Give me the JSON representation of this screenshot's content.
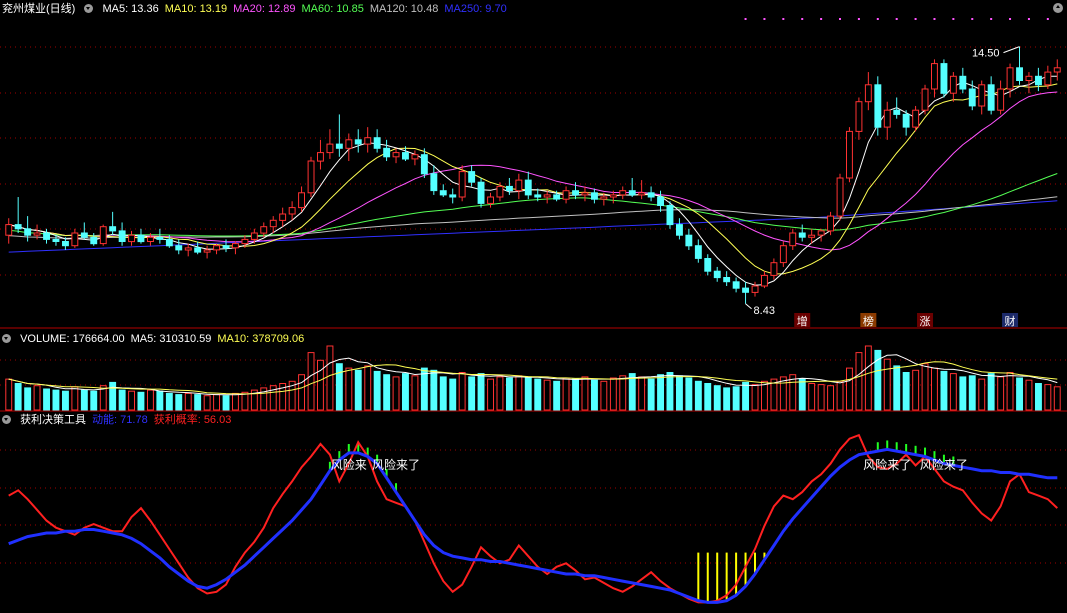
{
  "colors": {
    "up": "#ff3232",
    "down": "#54ffff",
    "ma5": "#ffffff",
    "ma10": "#ffff54",
    "ma20": "#ff54ff",
    "ma60": "#54ff54",
    "ma120": "#c0c0c0",
    "ma250": "#3030ff",
    "divider": "#b40000",
    "grid": "#a00000"
  },
  "price_panel": {
    "title": "兖州煤业(日线)",
    "ma_labels": [
      {
        "text": "MA5: 13.36",
        "color": "#ffffff"
      },
      {
        "text": "MA10: 13.19",
        "color": "#ffff54"
      },
      {
        "text": "MA20: 12.89",
        "color": "#ff54ff"
      },
      {
        "text": "MA60: 10.85",
        "color": "#54ff54"
      },
      {
        "text": "MA120: 10.48",
        "color": "#c0c0c0"
      },
      {
        "text": "MA250: 9.70",
        "color": "#3030ff"
      }
    ],
    "high_label": "14.50",
    "low_label": "8.43",
    "event_tags": [
      {
        "text": "增",
        "color": "#ffffff",
        "bg": "#6a0000",
        "bar": 84
      },
      {
        "text": "榜",
        "color": "#ffffff",
        "bg": "#8a3a00",
        "bar": 91
      },
      {
        "text": "涨",
        "color": "#ffffff",
        "bg": "#6a0000",
        "bar": 97
      },
      {
        "text": "财",
        "color": "#ffffff",
        "bg": "#1c2a6a",
        "bar": 106
      }
    ]
  },
  "volume_panel": {
    "labels": [
      {
        "text": "VOLUME: 176664.00",
        "color": "#ffffff"
      },
      {
        "text": "MA5: 310310.59",
        "color": "#ffffff"
      },
      {
        "text": "MA10: 378709.06",
        "color": "#ffff54"
      }
    ]
  },
  "indicator_panel": {
    "labels": [
      {
        "text": "获利决策工具",
        "color": "#ffffff"
      },
      {
        "text": "动能: 71.78",
        "color": "#3030ff"
      },
      {
        "text": "获利概率: 56.03",
        "color": "#ff2020"
      }
    ],
    "warning_text": "风险来了",
    "warnings": [
      {
        "text": "风险来",
        "bar": 36
      },
      {
        "text": "风险来了",
        "bar": 41
      },
      {
        "text": "风险来了",
        "bar": 93
      },
      {
        "text": "风险来了",
        "bar": 99
      }
    ]
  },
  "chart_data": [
    {
      "type": "candlestick",
      "name": "兖州煤业(日线)",
      "ylim": [
        8.0,
        15.2
      ],
      "ohlc": [
        [
          10.05,
          10.45,
          9.85,
          10.3
        ],
        [
          10.3,
          10.95,
          10.1,
          10.2
        ],
        [
          10.2,
          10.5,
          9.9,
          10.05
        ],
        [
          10.05,
          10.3,
          9.95,
          10.1
        ],
        [
          10.1,
          10.2,
          9.85,
          9.95
        ],
        [
          9.95,
          10.05,
          9.8,
          9.9
        ],
        [
          9.9,
          10.0,
          9.7,
          9.8
        ],
        [
          9.8,
          10.2,
          9.75,
          10.1
        ],
        [
          10.1,
          10.35,
          9.95,
          10.0
        ],
        [
          10.0,
          10.1,
          9.8,
          9.85
        ],
        [
          9.85,
          10.3,
          9.8,
          10.25
        ],
        [
          10.25,
          10.6,
          10.05,
          10.15
        ],
        [
          10.15,
          10.35,
          9.8,
          9.9
        ],
        [
          9.9,
          10.15,
          9.8,
          10.05
        ],
        [
          10.05,
          10.2,
          9.85,
          9.9
        ],
        [
          9.9,
          10.1,
          9.8,
          10.0
        ],
        [
          10.0,
          10.2,
          9.85,
          9.95
        ],
        [
          9.95,
          10.05,
          9.75,
          9.8
        ],
        [
          9.8,
          9.95,
          9.6,
          9.7
        ],
        [
          9.7,
          9.85,
          9.55,
          9.75
        ],
        [
          9.75,
          9.9,
          9.6,
          9.65
        ],
        [
          9.65,
          9.8,
          9.5,
          9.7
        ],
        [
          9.7,
          9.85,
          9.6,
          9.8
        ],
        [
          9.8,
          9.95,
          9.65,
          9.75
        ],
        [
          9.75,
          9.9,
          9.6,
          9.85
        ],
        [
          9.85,
          10.05,
          9.75,
          9.95
        ],
        [
          9.95,
          10.2,
          9.85,
          10.1
        ],
        [
          10.1,
          10.35,
          10.0,
          10.25
        ],
        [
          10.25,
          10.5,
          10.1,
          10.4
        ],
        [
          10.4,
          10.7,
          10.25,
          10.55
        ],
        [
          10.55,
          10.85,
          10.4,
          10.7
        ],
        [
          10.7,
          11.2,
          10.6,
          11.05
        ],
        [
          11.05,
          11.9,
          10.95,
          11.8
        ],
        [
          11.8,
          12.3,
          11.6,
          12.0
        ],
        [
          12.0,
          12.55,
          11.85,
          12.2
        ],
        [
          12.2,
          12.9,
          11.9,
          12.1
        ],
        [
          12.1,
          12.45,
          11.8,
          12.3
        ],
        [
          12.3,
          12.55,
          12.0,
          12.2
        ],
        [
          12.2,
          12.6,
          12.0,
          12.35
        ],
        [
          12.35,
          12.55,
          12.0,
          12.1
        ],
        [
          12.1,
          12.3,
          11.8,
          11.9
        ],
        [
          11.9,
          12.1,
          11.75,
          12.0
        ],
        [
          12.0,
          12.15,
          11.8,
          11.85
        ],
        [
          11.85,
          12.05,
          11.7,
          11.95
        ],
        [
          11.95,
          12.1,
          11.4,
          11.5
        ],
        [
          11.5,
          11.7,
          11.0,
          11.1
        ],
        [
          11.1,
          11.25,
          10.95,
          11.0
        ],
        [
          11.0,
          11.15,
          10.8,
          10.95
        ],
        [
          10.95,
          11.7,
          10.85,
          11.55
        ],
        [
          11.55,
          11.7,
          11.2,
          11.3
        ],
        [
          11.3,
          11.4,
          10.7,
          10.8
        ],
        [
          10.8,
          11.05,
          10.7,
          10.95
        ],
        [
          10.95,
          11.3,
          10.85,
          11.2
        ],
        [
          11.2,
          11.4,
          11.0,
          11.1
        ],
        [
          11.1,
          11.5,
          10.9,
          11.35
        ],
        [
          11.35,
          11.55,
          10.9,
          11.0
        ],
        [
          11.0,
          11.15,
          10.85,
          10.95
        ],
        [
          10.95,
          11.1,
          10.8,
          11.0
        ],
        [
          11.0,
          11.1,
          10.85,
          10.9
        ],
        [
          10.9,
          11.2,
          10.8,
          11.1
        ],
        [
          11.1,
          11.3,
          10.9,
          11.0
        ],
        [
          11.0,
          11.2,
          10.85,
          11.05
        ],
        [
          11.05,
          11.15,
          10.8,
          10.9
        ],
        [
          10.9,
          11.05,
          10.75,
          10.95
        ],
        [
          10.95,
          11.1,
          10.8,
          11.0
        ],
        [
          11.0,
          11.2,
          10.9,
          11.1
        ],
        [
          11.1,
          11.4,
          10.95,
          11.0
        ],
        [
          11.0,
          11.35,
          10.9,
          11.05
        ],
        [
          11.05,
          11.2,
          10.85,
          10.95
        ],
        [
          10.95,
          11.1,
          10.6,
          10.75
        ],
        [
          10.75,
          10.85,
          10.2,
          10.3
        ],
        [
          10.3,
          10.45,
          9.95,
          10.05
        ],
        [
          10.05,
          10.2,
          9.7,
          9.8
        ],
        [
          9.8,
          9.95,
          9.4,
          9.5
        ],
        [
          9.5,
          9.6,
          9.1,
          9.2
        ],
        [
          9.2,
          9.3,
          8.95,
          9.05
        ],
        [
          9.05,
          9.2,
          8.85,
          8.95
        ],
        [
          8.95,
          9.05,
          8.7,
          8.8
        ],
        [
          8.8,
          8.95,
          8.43,
          8.7
        ],
        [
          8.7,
          8.95,
          8.6,
          8.85
        ],
        [
          8.85,
          9.2,
          8.8,
          9.1
        ],
        [
          9.1,
          9.5,
          9.0,
          9.4
        ],
        [
          9.4,
          9.9,
          9.3,
          9.8
        ],
        [
          9.8,
          10.2,
          9.7,
          10.1
        ],
        [
          10.1,
          10.3,
          9.9,
          10.0
        ],
        [
          10.0,
          10.2,
          9.85,
          10.05
        ],
        [
          10.05,
          10.2,
          9.9,
          10.15
        ],
        [
          10.15,
          10.6,
          10.05,
          10.5
        ],
        [
          10.5,
          11.5,
          10.4,
          11.4
        ],
        [
          11.4,
          12.6,
          11.3,
          12.5
        ],
        [
          12.5,
          13.3,
          12.3,
          13.2
        ],
        [
          13.2,
          13.9,
          13.0,
          13.6
        ],
        [
          13.6,
          13.8,
          12.4,
          12.6
        ],
        [
          12.6,
          13.2,
          12.3,
          13.0
        ],
        [
          13.0,
          13.3,
          12.8,
          12.9
        ],
        [
          12.9,
          13.0,
          12.4,
          12.6
        ],
        [
          12.6,
          13.1,
          12.5,
          13.0
        ],
        [
          13.0,
          13.6,
          12.9,
          13.5
        ],
        [
          13.5,
          14.2,
          13.3,
          14.1
        ],
        [
          14.1,
          14.2,
          13.3,
          13.4
        ],
        [
          13.4,
          13.9,
          13.2,
          13.8
        ],
        [
          13.8,
          14.0,
          13.4,
          13.5
        ],
        [
          13.5,
          13.7,
          13.0,
          13.1
        ],
        [
          13.1,
          13.7,
          12.9,
          13.6
        ],
        [
          13.6,
          13.8,
          12.9,
          13.0
        ],
        [
          13.0,
          13.7,
          12.9,
          13.5
        ],
        [
          13.5,
          14.1,
          13.3,
          14.0
        ],
        [
          14.0,
          14.5,
          13.6,
          13.7
        ],
        [
          13.7,
          13.9,
          13.4,
          13.8
        ],
        [
          13.8,
          14.0,
          13.45,
          13.6
        ],
        [
          13.6,
          14.05,
          13.5,
          13.9
        ],
        [
          13.9,
          14.2,
          13.7,
          14.0
        ]
      ],
      "volume": [
        28,
        24,
        20,
        22,
        19,
        18,
        17,
        21,
        18,
        17,
        22,
        25,
        18,
        17,
        16,
        18,
        17,
        15,
        14,
        15,
        14,
        13,
        14,
        13,
        15,
        16,
        18,
        20,
        22,
        24,
        26,
        32,
        52,
        45,
        58,
        42,
        38,
        36,
        40,
        35,
        32,
        30,
        33,
        31,
        38,
        36,
        30,
        28,
        34,
        30,
        33,
        28,
        30,
        29,
        31,
        30,
        28,
        27,
        26,
        29,
        28,
        30,
        27,
        26,
        29,
        31,
        33,
        30,
        28,
        32,
        34,
        31,
        29,
        26,
        24,
        22,
        20,
        21,
        25,
        23,
        26,
        28,
        30,
        32,
        28,
        24,
        23,
        22,
        26,
        38,
        52,
        58,
        54,
        46,
        40,
        34,
        36,
        42,
        38,
        35,
        33,
        30,
        31,
        28,
        33,
        30,
        34,
        29,
        27,
        24,
        23,
        21
      ]
    },
    {
      "type": "line",
      "name": "获利决策工具",
      "ylim": [
        0,
        100
      ],
      "series": [
        {
          "name": "动能",
          "values": [
            35,
            37,
            39,
            40,
            41,
            41,
            42,
            42,
            43,
            43,
            42,
            41,
            40,
            38,
            35,
            31,
            27,
            22,
            18,
            14,
            11,
            10,
            12,
            15,
            19,
            23,
            28,
            33,
            38,
            43,
            48,
            54,
            60,
            68,
            76,
            82,
            86,
            86,
            84,
            80,
            72,
            64,
            56,
            48,
            40,
            34,
            30,
            28,
            27,
            26,
            26,
            25,
            25,
            24,
            23,
            22,
            21,
            20,
            19,
            18,
            18,
            17,
            17,
            16,
            15,
            14,
            13,
            12,
            11,
            10,
            9,
            7,
            5,
            3,
            2,
            2,
            3,
            6,
            11,
            18,
            26,
            34,
            42,
            49,
            55,
            61,
            67,
            73,
            78,
            82,
            85,
            86,
            87,
            88,
            87,
            86,
            85,
            84,
            82,
            80,
            79,
            78,
            77,
            76,
            76,
            75,
            75,
            74,
            74,
            73,
            72,
            72
          ]
        },
        {
          "name": "获利概率",
          "values": [
            62,
            65,
            60,
            54,
            48,
            44,
            42,
            40,
            44,
            46,
            44,
            42,
            42,
            50,
            55,
            48,
            40,
            32,
            24,
            16,
            10,
            7,
            8,
            12,
            22,
            30,
            36,
            44,
            55,
            63,
            70,
            78,
            84,
            91,
            85,
            70,
            80,
            92,
            84,
            70,
            60,
            58,
            56,
            48,
            36,
            24,
            14,
            8,
            12,
            22,
            33,
            28,
            24,
            26,
            34,
            28,
            22,
            18,
            22,
            24,
            20,
            15,
            16,
            13,
            10,
            8,
            11,
            15,
            19,
            14,
            10,
            7,
            4,
            2,
            2,
            3,
            6,
            12,
            22,
            32,
            45,
            56,
            62,
            60,
            64,
            70,
            74,
            80,
            88,
            94,
            96,
            84,
            78,
            77,
            80,
            85,
            79,
            84,
            77,
            70,
            67,
            65,
            58,
            52,
            48,
            56,
            70,
            74,
            64,
            62,
            60,
            55
          ]
        }
      ]
    }
  ]
}
